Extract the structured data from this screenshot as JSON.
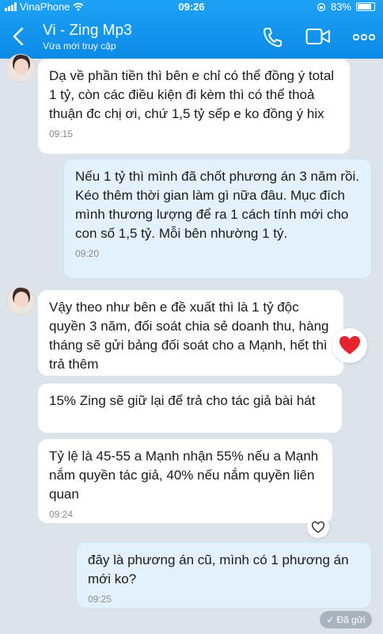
{
  "status_bar": {
    "carrier": "VinaPhone",
    "time": "09:26",
    "battery": "83%"
  },
  "header": {
    "name": "Vi - Zing Mp3",
    "status": "Vừa mới truy cập"
  },
  "messages": [
    {
      "dir": "in",
      "text": "Dạ về phần tiền thì bên e chỉ có thể đồng ý total 1 tỷ, còn các điều kiện đi kèm thì có thể thoả thuận đc chị ơi, chứ 1,5 tỷ sếp e ko đồng ý hix",
      "time": "09:15"
    },
    {
      "dir": "out",
      "text": "Nếu 1 tỷ thì mình đã chốt phương án 3 năm rồi. Kéo thêm thời gian làm gì nữa đâu. Mục đích mình thương lượng để ra 1 cách tính mới cho con số 1,5 tỷ. Mỗi bên nhường 1 tý.",
      "time": "09:20"
    },
    {
      "dir": "in",
      "text": "Vậy theo như bên e đề xuất thì là 1 tỷ độc quyền 3 năm, đối soát chia sẻ doanh thu, hàng tháng sẽ gửi bảng đối soát cho a Mạnh, hết thì trả thêm"
    },
    {
      "dir": "in",
      "text": "15% Zing sẽ giữ lại để trả cho tác giả bài hát"
    },
    {
      "dir": "in",
      "text": "Tỷ lệ là 45-55 a Mạnh nhận 55% nếu a Mạnh nắm quyền tác giả, 40% nếu nắm quyền liên quan",
      "time": "09:24"
    },
    {
      "dir": "out",
      "text": "đây là phương án cũ, mình có 1 phương án mới ko?",
      "time": "09:25"
    }
  ],
  "sent_label": "Đã gửi",
  "colors": {
    "header": "#0c8ae6",
    "incoming": "#ffffff",
    "outgoing": "#e3f1fd",
    "background": "#dde3ea"
  }
}
